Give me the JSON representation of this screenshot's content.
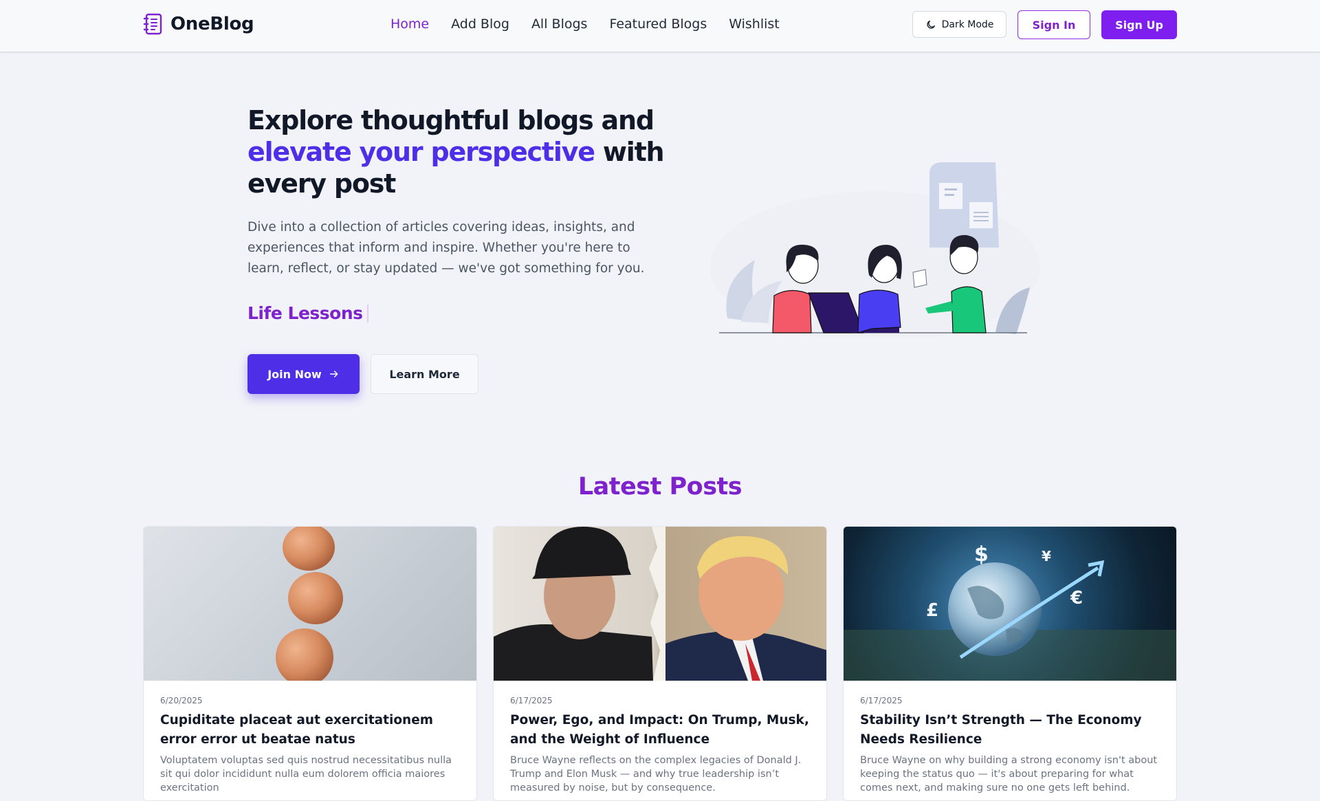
{
  "brand": {
    "name": "OneBlog",
    "icon": "notebook-icon",
    "accent": "#7e22ce"
  },
  "nav": {
    "links": [
      {
        "label": "Home",
        "active": true
      },
      {
        "label": "Add Blog",
        "active": false
      },
      {
        "label": "All Blogs",
        "active": false
      },
      {
        "label": "Featured Blogs",
        "active": false
      },
      {
        "label": "Wishlist",
        "active": false
      }
    ],
    "dark_mode_label": "Dark Mode",
    "dark_mode_icon": "moon-icon",
    "sign_in_label": "Sign In",
    "sign_up_label": "Sign Up"
  },
  "hero": {
    "title_part1": "Explore thoughtful blogs and",
    "title_accent": "elevate your perspective",
    "title_part2": "with",
    "title_part3": "every post",
    "description": "Dive into a collection of articles covering ideas, insights, and experiences that inform and inspire. Whether you're here to learn, reflect, or stay updated — we've got something for you.",
    "typed_text": "Life Lessons",
    "join_label": "Join Now",
    "learn_label": "Learn More",
    "primary_color": "#4f2ee8"
  },
  "latest": {
    "title": "Latest Posts",
    "posts": [
      {
        "date": "6/20/2025",
        "title": "Cupiditate placeat aut exercitationem error error ut beatae natus",
        "excerpt": "Voluptatem voluptas sed quis nostrud necessitatibus nulla sit qui dolor incididunt nulla eum dolorem officia maiores exercitation",
        "image": "stacked-eggs-photo"
      },
      {
        "date": "6/17/2025",
        "title": "Power, Ego, and Impact: On Trump, Musk, and the Weight of Influence",
        "excerpt": "Bruce Wayne reflects on the complex legacies of Donald J. Trump and Elon Musk — and why true leadership isn’t measured by noise, but by consequence.",
        "image": "two-men-portrait-photo"
      },
      {
        "date": "6/17/2025",
        "title": "Stability Isn’t Strength — The Economy Needs Resilience",
        "excerpt": "Bruce Wayne on why building a strong economy isn't about keeping the status quo — it's about preparing for what comes next, and making sure no one gets left behind.",
        "image": "globe-currency-photo"
      }
    ]
  }
}
